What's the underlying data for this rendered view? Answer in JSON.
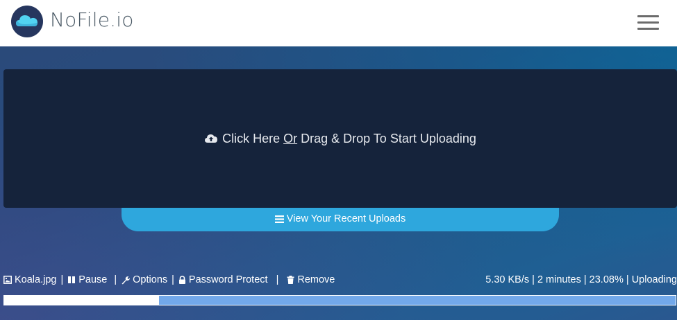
{
  "header": {
    "brand": "NoFile.io",
    "logo_icon": "cloud-logo-icon",
    "menu_icon": "hamburger-menu-icon"
  },
  "dropzone": {
    "text_before": "Click Here ",
    "text_or": "Or",
    "text_after": " Drag & Drop To Start Uploading",
    "icon": "cloud-upload-icon"
  },
  "recent_uploads": {
    "label": "View Your Recent Uploads",
    "icon": "list-icon"
  },
  "upload": {
    "filename": "Koala.jpg",
    "pause_label": "Pause",
    "options_label": "Options",
    "password_label": "Password Protect",
    "remove_label": "Remove",
    "speed": "5.30 KB/s",
    "eta": "2 minutes",
    "percent": "23.08%",
    "status": "Uploading",
    "progress_fraction": 0.2308
  },
  "colors": {
    "accent": "#2ea7dd",
    "dropzone_bg": "#15233b",
    "progress_bg": "#72a8ea",
    "progress_fill": "#ffffff"
  }
}
